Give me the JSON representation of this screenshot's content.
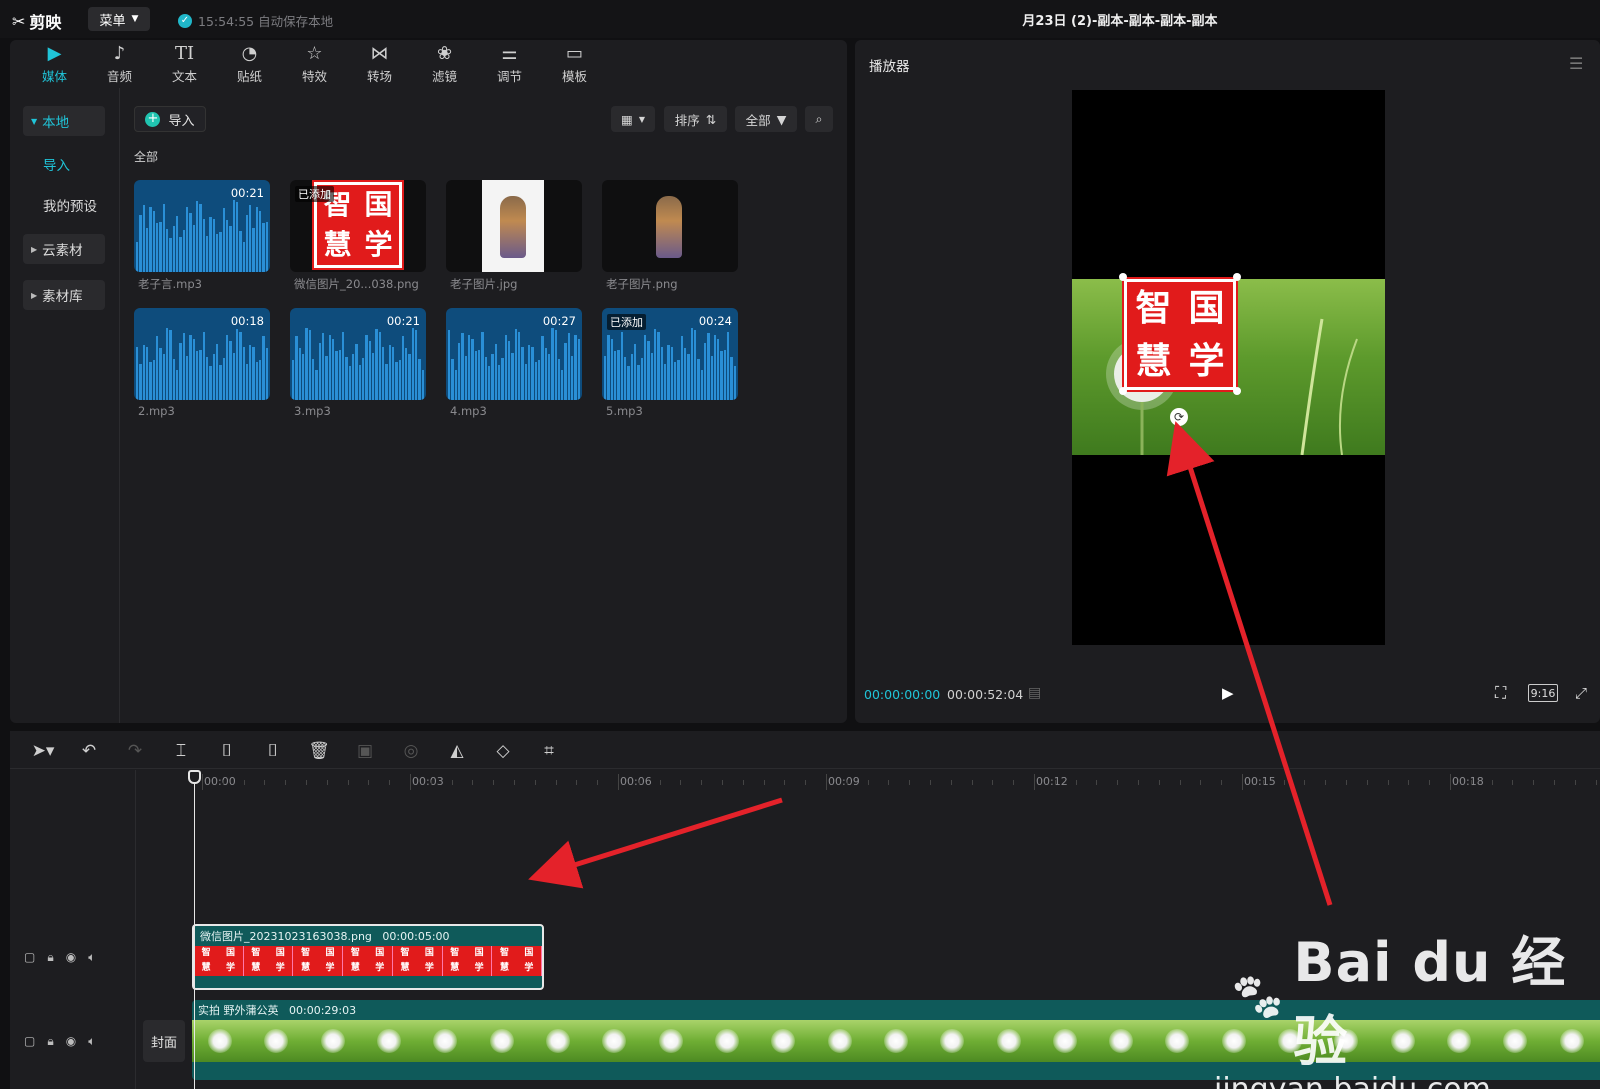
{
  "app": {
    "name": "剪映",
    "menu_label": "菜单",
    "save_status": "15:54:55 自动保存本地",
    "doc_title": "月23日 (2)-副本-副本-副本-副本"
  },
  "tools": [
    {
      "label": "媒体",
      "icon": "▶",
      "active": true
    },
    {
      "label": "音频",
      "icon": "♪"
    },
    {
      "label": "文本",
      "icon": "TI"
    },
    {
      "label": "贴纸",
      "icon": "◔"
    },
    {
      "label": "特效",
      "icon": "☆"
    },
    {
      "label": "转场",
      "icon": "⋈"
    },
    {
      "label": "滤镜",
      "icon": "❀"
    },
    {
      "label": "调节",
      "icon": "⚌"
    },
    {
      "label": "模板",
      "icon": "▭"
    }
  ],
  "subnav": {
    "local": "本地",
    "import": "导入",
    "presets": "我的预设",
    "cloud": "云素材",
    "library": "素材库"
  },
  "media": {
    "import_label": "导入",
    "sort_label": "排序",
    "filter_label": "全部",
    "section_label": "全部",
    "added_badge": "已添加",
    "items": [
      {
        "name": "老子言.mp3",
        "type": "audio",
        "duration": "00:21"
      },
      {
        "name": "微信图片_20...038.png",
        "type": "seal",
        "added": true
      },
      {
        "name": "老子图片.jpg",
        "type": "figure-white"
      },
      {
        "name": "老子图片.png",
        "type": "figure-dark"
      },
      {
        "name": "2.mp3",
        "type": "audio",
        "duration": "00:18"
      },
      {
        "name": "3.mp3",
        "type": "audio",
        "duration": "00:21"
      },
      {
        "name": "4.mp3",
        "type": "audio",
        "duration": "00:27"
      },
      {
        "name": "5.mp3",
        "type": "audio",
        "duration": "00:24",
        "added": true
      }
    ]
  },
  "seal_chars": [
    "智",
    "国",
    "慧",
    "学"
  ],
  "player": {
    "title": "播放器",
    "current_time": "00:00:00:00",
    "total_time": "00:00:52:04",
    "ratio": "9:16"
  },
  "timeline": {
    "ticks": [
      "00:00",
      "00:03",
      "00:06",
      "00:09",
      "00:12",
      "00:15",
      "00:18"
    ],
    "clip1": {
      "name": "微信图片_20231023163038.png",
      "duration": "00:00:05:00"
    },
    "clip2": {
      "name": "实拍 野外蒲公英",
      "duration": "00:00:29:03"
    },
    "cover_label": "封面"
  },
  "watermark": {
    "main": "Bai du 经验",
    "sub": "jingyan.baidu.com"
  },
  "colors": {
    "accent": "#20c4d8",
    "seal_red": "#e11b1b",
    "arrow": "#e4222a",
    "clip_teal": "#0f5a5a"
  }
}
